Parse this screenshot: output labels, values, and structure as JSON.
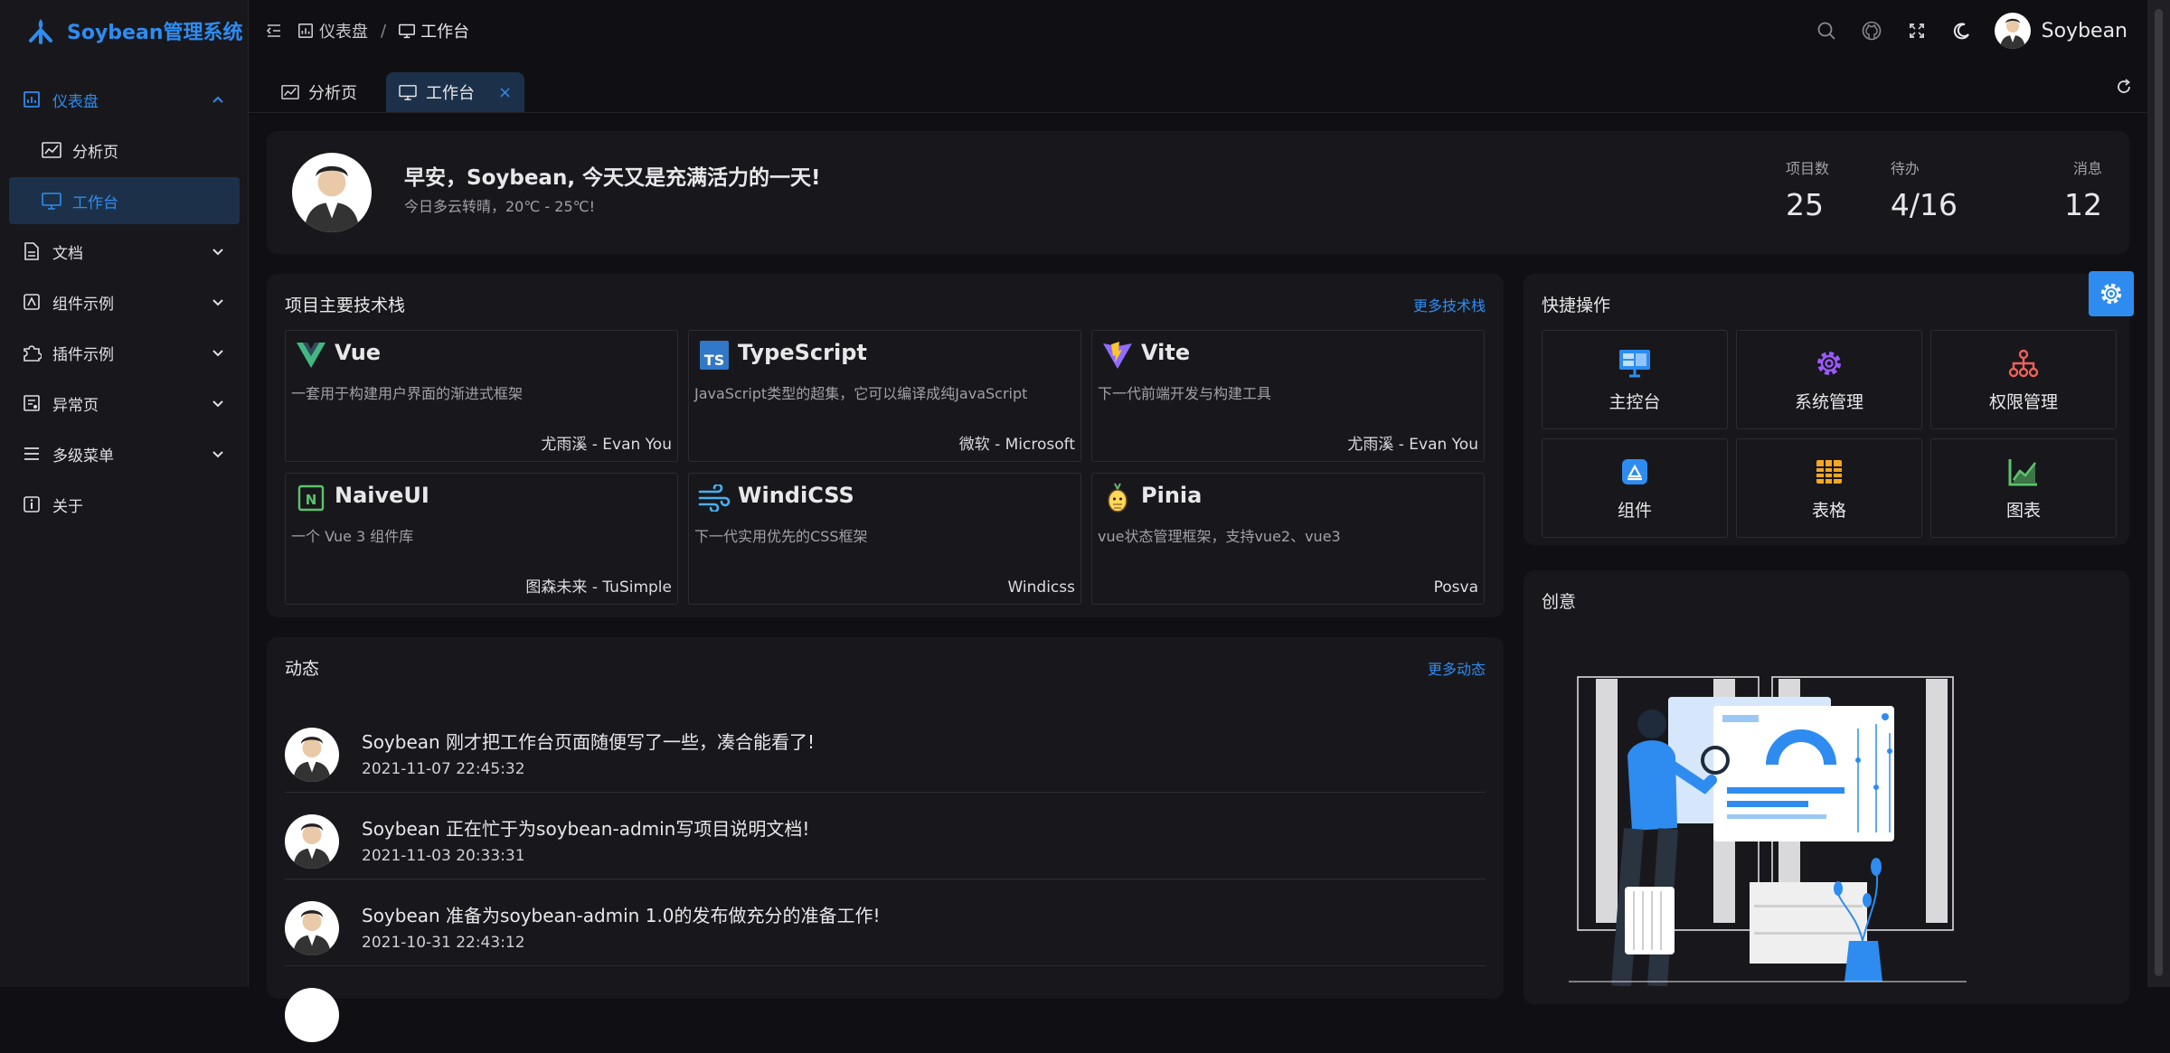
{
  "app": {
    "title": "Soybean管理系统"
  },
  "sidebar": {
    "items": [
      {
        "label": "仪表盘",
        "icon": "dashboard-icon"
      },
      {
        "label": "分析页",
        "icon": "chart-icon"
      },
      {
        "label": "工作台",
        "icon": "monitor-icon"
      },
      {
        "label": "文档",
        "icon": "document-icon"
      },
      {
        "label": "组件示例",
        "icon": "component-icon"
      },
      {
        "label": "插件示例",
        "icon": "plugin-icon"
      },
      {
        "label": "异常页",
        "icon": "exception-icon"
      },
      {
        "label": "多级菜单",
        "icon": "menu-icon"
      },
      {
        "label": "关于",
        "icon": "info-icon"
      }
    ]
  },
  "header": {
    "breadcrumb": [
      "仪表盘",
      "工作台"
    ],
    "user_name": "Soybean"
  },
  "tabs": [
    {
      "label": "分析页"
    },
    {
      "label": "工作台",
      "close": "×"
    }
  ],
  "greeting": {
    "title": "早安，Soybean, 今天又是充满活力的一天!",
    "subtitle": "今日多云转晴，20℃ - 25℃!",
    "stats": [
      {
        "label": "项目数",
        "value": "25"
      },
      {
        "label": "待办",
        "value": "4/16"
      },
      {
        "label": "消息",
        "value": "12"
      }
    ]
  },
  "tech": {
    "title": "项目主要技术栈",
    "more": "更多技术栈",
    "items": [
      {
        "name": "Vue",
        "desc": "一套用于构建用户界面的渐进式框架",
        "author": "尤雨溪 - Evan You"
      },
      {
        "name": "TypeScript",
        "desc": "JavaScript类型的超集，它可以编译成纯JavaScript",
        "author": "微软 - Microsoft"
      },
      {
        "name": "Vite",
        "desc": "下一代前端开发与构建工具",
        "author": "尤雨溪 - Evan You"
      },
      {
        "name": "NaiveUI",
        "desc": "一个 Vue 3 组件库",
        "author": "图森未来 - TuSimple"
      },
      {
        "name": "WindiCSS",
        "desc": "下一代实用优先的CSS框架",
        "author": "Windicss"
      },
      {
        "name": "Pinia",
        "desc": "vue状态管理框架，支持vue2、vue3",
        "author": "Posva"
      }
    ]
  },
  "activity": {
    "title": "动态",
    "more": "更多动态",
    "items": [
      {
        "text": "Soybean 刚才把工作台页面随便写了一些，凑合能看了!",
        "time": "2021-11-07 22:45:32"
      },
      {
        "text": "Soybean 正在忙于为soybean-admin写项目说明文档!",
        "time": "2021-11-03 20:33:31"
      },
      {
        "text": "Soybean 准备为soybean-admin 1.0的发布做充分的准备工作!",
        "time": "2021-10-31 22:43:12"
      }
    ]
  },
  "quick": {
    "title": "快捷操作",
    "items": [
      {
        "label": "主控台",
        "icon": "monitor-icon",
        "color": "#2e8cf0"
      },
      {
        "label": "系统管理",
        "icon": "gear-icon",
        "color": "#9b59ff"
      },
      {
        "label": "权限管理",
        "icon": "hierarchy-icon",
        "color": "#f0605a"
      },
      {
        "label": "组件",
        "icon": "appstore-icon",
        "color": "#2e8cf0"
      },
      {
        "label": "表格",
        "icon": "table-icon",
        "color": "#f5a623"
      },
      {
        "label": "图表",
        "icon": "chart-icon",
        "color": "#5cc36b"
      }
    ]
  },
  "creative": {
    "title": "创意"
  },
  "colors": {
    "accent": "#2e8cf0",
    "background": "#101014",
    "card": "#18181c"
  }
}
